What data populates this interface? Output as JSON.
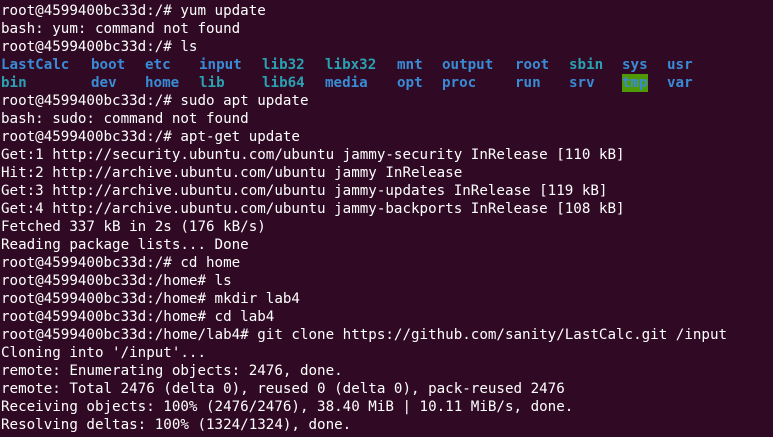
{
  "terminal": {
    "bg_color": "#300a24",
    "fg_color": "#ffffff",
    "lines_before": [
      "root@4599400bc33d:/# yum update",
      "bash: yum: command not found",
      "root@4599400bc33d:/# ls"
    ],
    "ls_root": {
      "row1": [
        {
          "name": "LastCalc",
          "type": "dir"
        },
        {
          "name": "boot",
          "type": "dir"
        },
        {
          "name": "etc",
          "type": "dir"
        },
        {
          "name": "input",
          "type": "dir"
        },
        {
          "name": "lib32",
          "type": "link"
        },
        {
          "name": "libx32",
          "type": "link"
        },
        {
          "name": "mnt",
          "type": "dir"
        },
        {
          "name": "output",
          "type": "dir"
        },
        {
          "name": "root",
          "type": "dir"
        },
        {
          "name": "sbin",
          "type": "link"
        },
        {
          "name": "sys",
          "type": "dir"
        },
        {
          "name": "usr",
          "type": "dir"
        }
      ],
      "row2": [
        {
          "name": "bin",
          "type": "link"
        },
        {
          "name": "dev",
          "type": "dir"
        },
        {
          "name": "home",
          "type": "dir"
        },
        {
          "name": "lib",
          "type": "link"
        },
        {
          "name": "lib64",
          "type": "link"
        },
        {
          "name": "media",
          "type": "dir"
        },
        {
          "name": "opt",
          "type": "dir"
        },
        {
          "name": "proc",
          "type": "dir"
        },
        {
          "name": "run",
          "type": "dir"
        },
        {
          "name": "srv",
          "type": "dir"
        },
        {
          "name": "tmp",
          "type": "sticky"
        },
        {
          "name": "var",
          "type": "dir"
        }
      ]
    },
    "lines_after": [
      "root@4599400bc33d:/# sudo apt update",
      "bash: sudo: command not found",
      "root@4599400bc33d:/# apt-get update",
      "Get:1 http://security.ubuntu.com/ubuntu jammy-security InRelease [110 kB]",
      "Hit:2 http://archive.ubuntu.com/ubuntu jammy InRelease",
      "Get:3 http://archive.ubuntu.com/ubuntu jammy-updates InRelease [119 kB]",
      "Get:4 http://archive.ubuntu.com/ubuntu jammy-backports InRelease [108 kB]",
      "Fetched 337 kB in 2s (176 kB/s)",
      "Reading package lists... Done",
      "root@4599400bc33d:/# cd home",
      "root@4599400bc33d:/home# ls",
      "root@4599400bc33d:/home# mkdir lab4",
      "root@4599400bc33d:/home# cd lab4",
      "root@4599400bc33d:/home/lab4# git clone https://github.com/sanity/LastCalc.git /input",
      "Cloning into '/input'...",
      "remote: Enumerating objects: 2476, done.",
      "remote: Total 2476 (delta 0), reused 0 (delta 0), pack-reused 2476",
      "Receiving objects: 100% (2476/2476), 38.40 MiB | 10.11 MiB/s, done.",
      "Resolving deltas: 100% (1324/1324), done."
    ]
  }
}
